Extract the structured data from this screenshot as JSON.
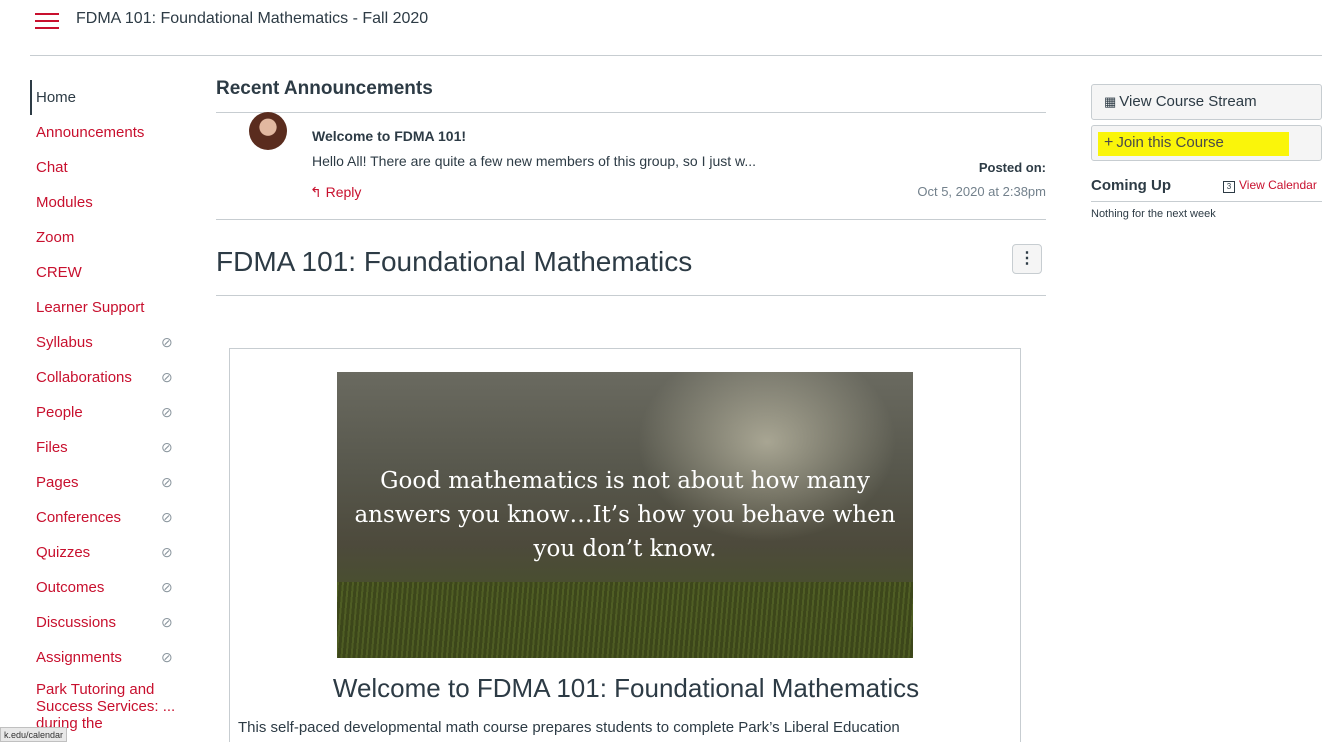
{
  "header": {
    "title": "FDMA 101: Foundational Mathematics - Fall 2020"
  },
  "nav": {
    "items": [
      {
        "label": "Home",
        "active": true,
        "hidden": false
      },
      {
        "label": "Announcements",
        "hidden": false
      },
      {
        "label": "Chat",
        "hidden": false
      },
      {
        "label": "Modules",
        "hidden": false
      },
      {
        "label": "Zoom",
        "hidden": false
      },
      {
        "label": "CREW",
        "hidden": false
      },
      {
        "label": "Learner Support",
        "hidden": false
      },
      {
        "label": "Syllabus",
        "hidden": true
      },
      {
        "label": "Collaborations",
        "hidden": true
      },
      {
        "label": "People",
        "hidden": true
      },
      {
        "label": "Files",
        "hidden": true
      },
      {
        "label": "Pages",
        "hidden": true
      },
      {
        "label": "Conferences",
        "hidden": true
      },
      {
        "label": "Quizzes",
        "hidden": true
      },
      {
        "label": "Outcomes",
        "hidden": true
      },
      {
        "label": "Discussions",
        "hidden": true
      },
      {
        "label": "Assignments",
        "hidden": true
      }
    ],
    "last_item": "Park Tutoring and Success Services: ... during the",
    "status_url": "k.edu/calendar"
  },
  "announcements": {
    "heading": "Recent Announcements",
    "title": "Welcome to FDMA 101!",
    "snippet": "Hello All! There are quite a few new members of this group, so I just w...",
    "reply": "Reply",
    "posted_label": "Posted on:",
    "posted_date": "Oct 5, 2020 at 2:38pm"
  },
  "page": {
    "heading": "FDMA 101: Foundational Mathematics",
    "kebab": "⋮",
    "hero_quote": "Good mathematics is not about how many answers you know…It’s how you behave when you don’t know.",
    "welcome_heading": "Welcome to FDMA 101: Foundational Mathematics",
    "welcome_text": "This self-paced developmental math course prepares students to complete Park’s Liberal Education"
  },
  "sidebar": {
    "view_stream": "View Course Stream",
    "join_course": "Join this Course",
    "coming_up": "Coming Up",
    "view_calendar": "View Calendar",
    "calendar_icon_num": "3",
    "nothing": "Nothing for the next week"
  },
  "colors": {
    "accent": "#c8102e",
    "text": "#2d3b45",
    "highlight": "#faf50a"
  }
}
